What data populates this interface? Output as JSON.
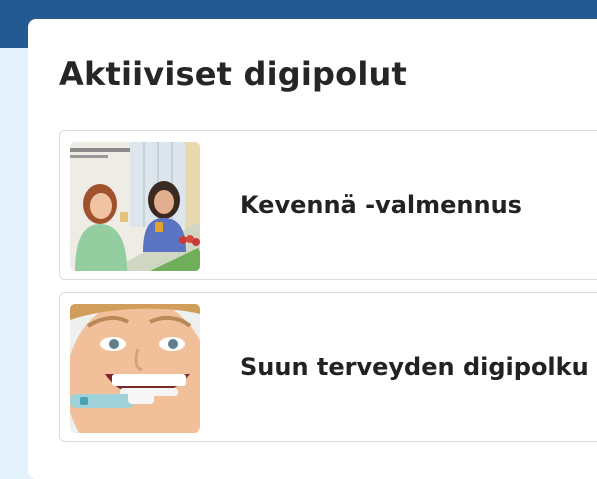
{
  "header": {
    "color": "#245a92"
  },
  "page": {
    "title": "Aktiiviset digipolut"
  },
  "digipaths": [
    {
      "title": "Kevennä -valmennus",
      "image": "two-women-chatting-over-coffee"
    },
    {
      "title": "Suun terveyden digipolku",
      "image": "child-brushing-teeth"
    }
  ]
}
